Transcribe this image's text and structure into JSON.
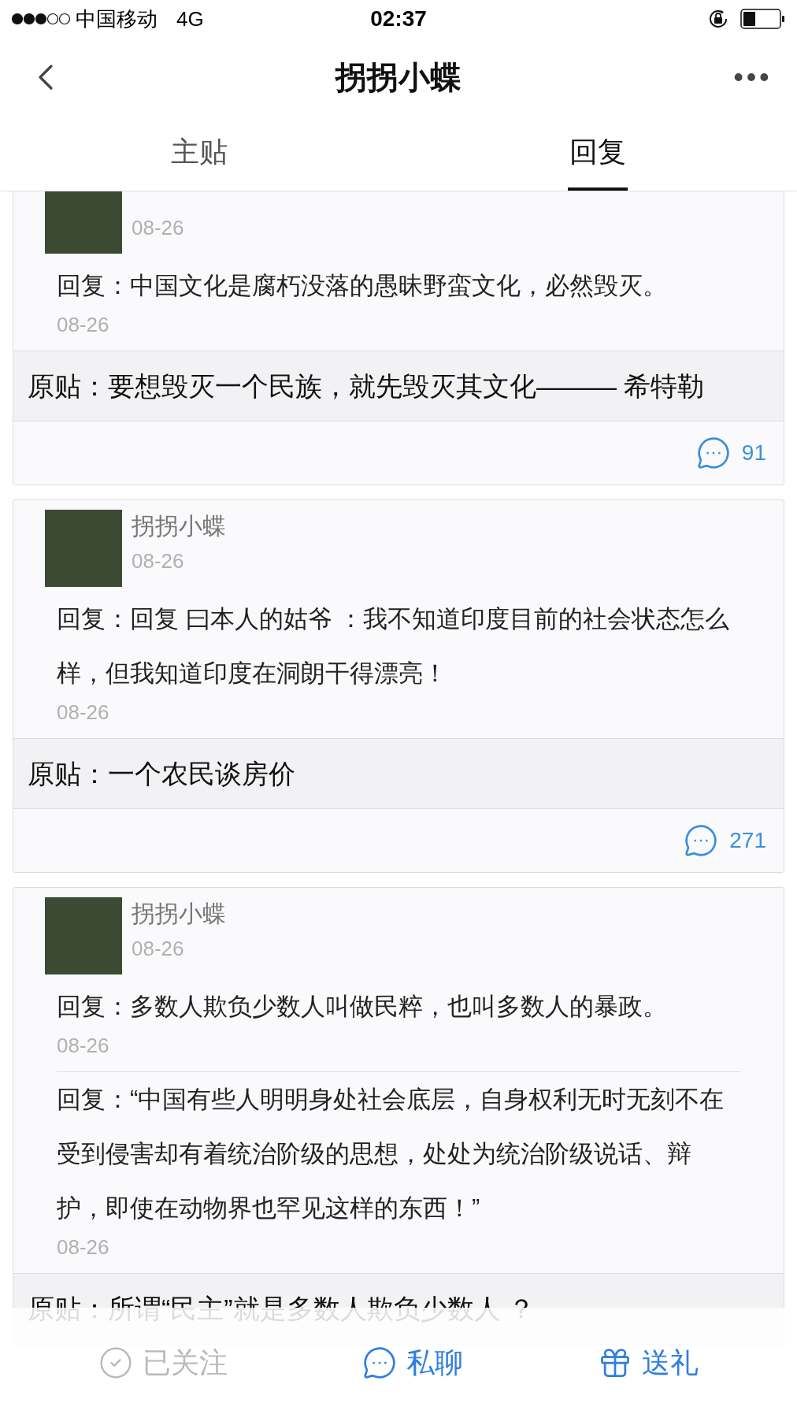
{
  "status_bar": {
    "carrier": "中国移动",
    "network": "4G",
    "time": "02:37"
  },
  "nav_bar": {
    "title": "拐拐小蝶"
  },
  "tabs": [
    {
      "label": "主贴",
      "selected": false
    },
    {
      "label": "回复",
      "selected": true
    }
  ],
  "posts": [
    {
      "date": "08-26",
      "replies": [
        {
          "text": "回复：中国文化是腐朽没落的愚昧野蛮文化，必然毁灭。",
          "date": "08-26"
        }
      ],
      "original": "原贴：要想毁灭一个民族，就先毁灭其文化——— 希特勒",
      "comments": "91"
    },
    {
      "author": "拐拐小蝶",
      "date": "08-26",
      "replies": [
        {
          "text": "回复：回复 曰本人的姑爷 ：我不知道印度目前的社会状态怎么样，但我知道印度在洞朗干得漂亮！",
          "date": "08-26"
        }
      ],
      "original": "原贴：一个农民谈房价",
      "comments": "271"
    },
    {
      "author": "拐拐小蝶",
      "date": "08-26",
      "replies": [
        {
          "text": "回复：多数人欺负少数人叫做民粹，也叫多数人的暴政。",
          "date": "08-26"
        },
        {
          "text": "回复：“中国有些人明明身处社会底层，自身权利无时无刻不在受到侵害却有着统治阶级的思想，处处为统治阶级说话、辩护，即使在动物界也罕见这样的东西！”",
          "date": "08-26"
        }
      ],
      "original": "原贴：所谓“民主”就是多数人欺负少数人 ？"
    }
  ],
  "bottom_bar": {
    "follow": "已关注",
    "chat": "私聊",
    "gift": "送礼"
  }
}
